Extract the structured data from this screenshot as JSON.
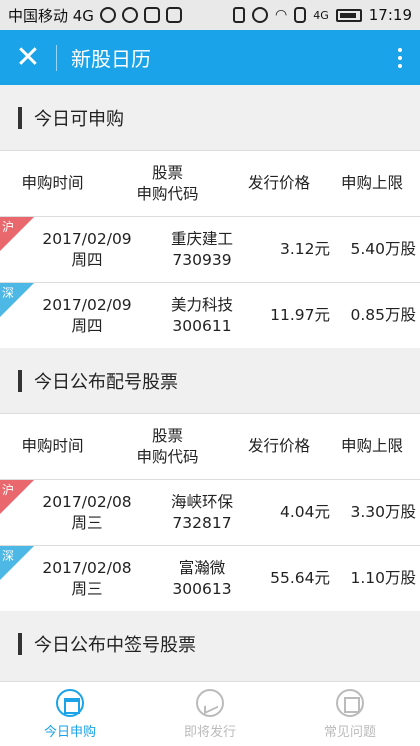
{
  "status_bar": {
    "carrier": "中国移动 4G",
    "network": "4G",
    "time": "17:19"
  },
  "app_bar": {
    "title": "新股日历"
  },
  "sections": [
    {
      "title": "今日可申购",
      "header": {
        "c1": "申购时间",
        "c2a": "股票",
        "c2b": "申购代码",
        "c3": "发行价格",
        "c4": "申购上限"
      },
      "rows": [
        {
          "market": "沪",
          "date": "2017/02/09",
          "weekday": "周四",
          "name": "重庆建工",
          "code": "730939",
          "price": "3.12元",
          "limit": "5.40万股"
        },
        {
          "market": "深",
          "date": "2017/02/09",
          "weekday": "周四",
          "name": "美力科技",
          "code": "300611",
          "price": "11.97元",
          "limit": "0.85万股"
        }
      ]
    },
    {
      "title": "今日公布配号股票",
      "header": {
        "c1": "申购时间",
        "c2a": "股票",
        "c2b": "申购代码",
        "c3": "发行价格",
        "c4": "申购上限"
      },
      "rows": [
        {
          "market": "沪",
          "date": "2017/02/08",
          "weekday": "周三",
          "name": "海峡环保",
          "code": "732817",
          "price": "4.04元",
          "limit": "3.30万股"
        },
        {
          "market": "深",
          "date": "2017/02/08",
          "weekday": "周三",
          "name": "富瀚微",
          "code": "300613",
          "price": "55.64元",
          "limit": "1.10万股"
        }
      ]
    },
    {
      "title": "今日公布中签号股票"
    }
  ],
  "tabs": [
    {
      "label": "今日申购",
      "active": true
    },
    {
      "label": "即将发行",
      "active": false
    },
    {
      "label": "常见问题",
      "active": false
    }
  ],
  "colors": {
    "primary": "#1aa3e8",
    "sh_corner": "#e8686e",
    "sz_corner": "#4db7e6"
  }
}
